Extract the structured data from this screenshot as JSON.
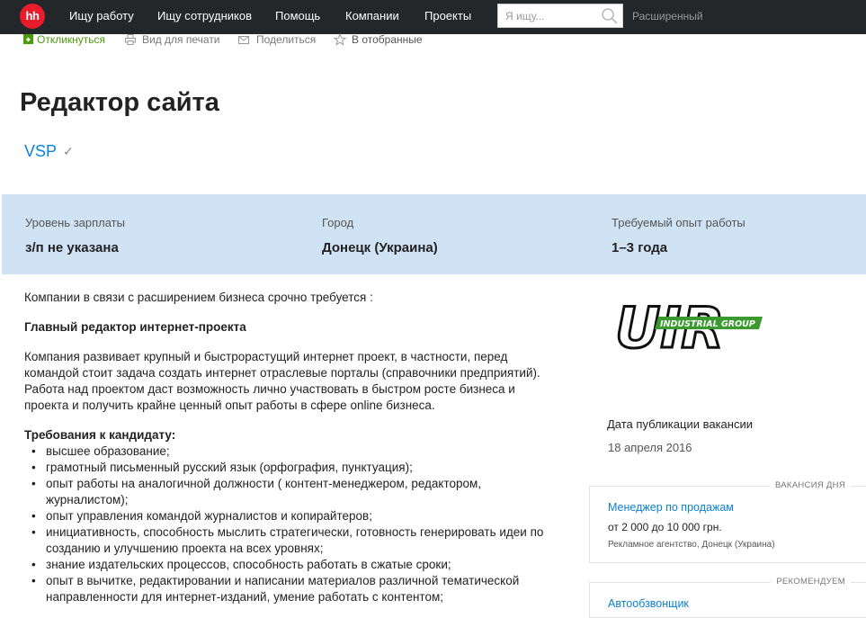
{
  "header": {
    "logo_text": "hh",
    "nav": [
      "Ищу работу",
      "Ищу сотрудников",
      "Помощь",
      "Компании",
      "Проекты"
    ],
    "search_placeholder": "Я ищу...",
    "advanced_label": "Расширенный"
  },
  "actions": {
    "respond": "Откликнуться",
    "print": "Вид для печати",
    "share": "Поделиться",
    "favorite": "В отобранные"
  },
  "vacancy": {
    "title": "Редактор сайта",
    "company": "VSP",
    "check_mark": "✓"
  },
  "info": {
    "salary_label": "Уровень зарплаты",
    "salary_value": "з/п не указана",
    "city_label": "Город",
    "city_value": "Донецк (Украина)",
    "experience_label": "Требуемый опыт работы",
    "experience_value": "1–3 года"
  },
  "description": {
    "intro": "Компании в связи с расширением бизнеса срочно требуется :",
    "position": "Главный редактор интернет-проекта",
    "about": "Компания развивает крупный и быстрорастущий интернет проект, в частности, перед командой стоит задача создать интернет отраслевые порталы (справочники предприятий). Работа над проектом даст возможность лично участвовать в быстром росте бизнеса и проекта и получить крайне ценный опыт работы в сфере online бизнеса.",
    "requirements_title": "Требования к кандидату:",
    "requirements": [
      "высшее образование;",
      "грамотный письменный русский язык (орфография, пунктуация);",
      "опыт работы на аналогичной должности ( контент-менеджером, редактором, журналистом);",
      "опыт управления командой журналистов и копирайтеров;",
      "инициативность, способность мыслить стратегически, готовность генерировать идеи по созданию и улучшению проекта на всех уровнях;",
      "знание издательских процессов, способность работать в сжатые сроки;",
      "опыт в вычитке, редактировании и написании материалов различной тематической направленности для интернет-изданий, умение работать с контентом;"
    ]
  },
  "sidebar": {
    "logo_text_main": "UIR",
    "logo_text_band": "INDUSTRIAL GROUP",
    "pub_label": "Дата публикации вакансии",
    "pub_date": "18 апреля 2016",
    "vacancy_of_day": {
      "tag": "ВАКАНСИЯ ДНЯ",
      "title": "Менеджер по продажам",
      "salary": "от 2 000 до 10 000 грн.",
      "company": "Рекламное агентство, Донецк (Украина)"
    },
    "recommended": {
      "tag": "РЕКОМЕНДУЕМ",
      "title": "Автообзвонщик"
    }
  },
  "colors": {
    "topbar": "#232729",
    "logo_red": "#e91c2b",
    "link_blue": "#0b81d8",
    "respond_green": "#4b9b0a",
    "band_blue": "#cfe3f5"
  }
}
